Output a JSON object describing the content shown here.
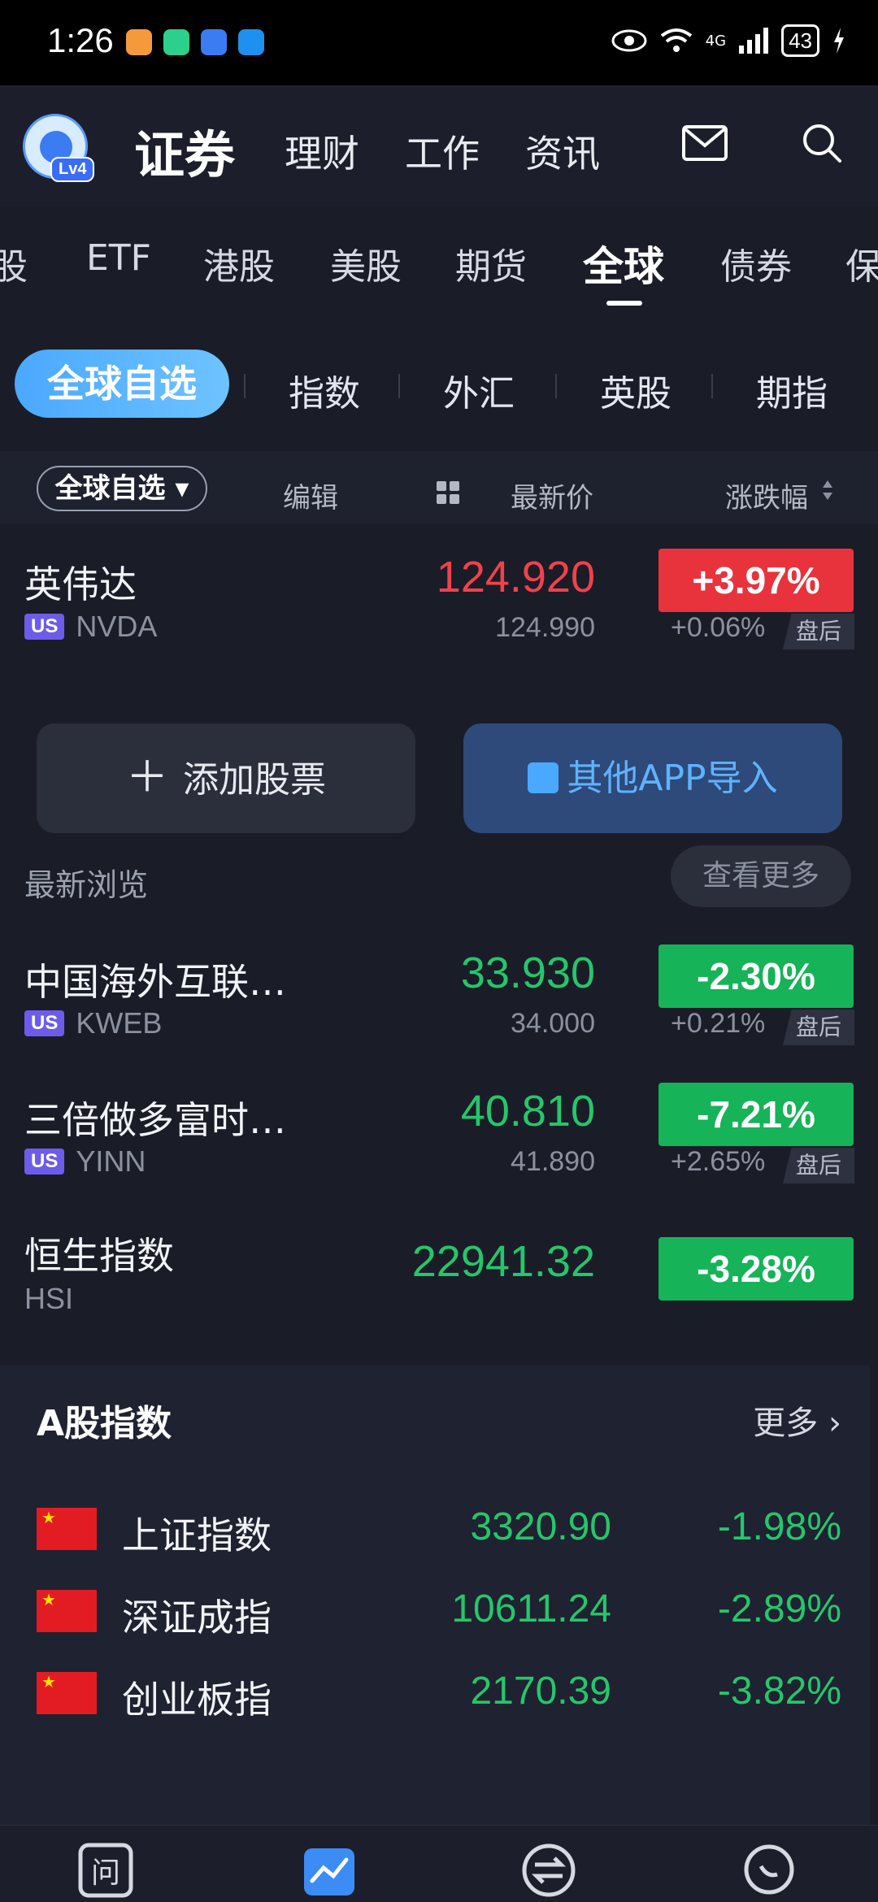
{
  "status_bar": {
    "time": "1:26",
    "network": "4G",
    "battery": "43"
  },
  "header": {
    "brand": "证券",
    "level": "Lv4",
    "nav": [
      "理财",
      "工作",
      "资讯"
    ]
  },
  "market_tabs": [
    "股",
    "ETF",
    "港股",
    "美股",
    "期货",
    "全球",
    "债券",
    "保"
  ],
  "market_tab_active": "全球",
  "sub_tabs": {
    "active": "全球自选",
    "items": [
      "指数",
      "外汇",
      "英股",
      "期指"
    ]
  },
  "watchlist_header": {
    "select": "全球自选 ▾",
    "edit": "编辑",
    "latest_price": "最新价",
    "change": "涨跌幅"
  },
  "watchlist": [
    {
      "name": "英伟达",
      "market": "US",
      "code": "NVDA",
      "price": "124.920",
      "after_price": "124.990",
      "change": "+3.97%",
      "after_change": "+0.06%",
      "after_label": "盘后",
      "direction": "up"
    }
  ],
  "buttons": {
    "add": "添加股票",
    "import": "其他APP导入"
  },
  "recent": {
    "title": "最新浏览",
    "see_more": "查看更多",
    "items": [
      {
        "name": "中国海外互联…",
        "market": "US",
        "code": "KWEB",
        "price": "33.930",
        "after_price": "34.000",
        "change": "-2.30%",
        "after_change": "+0.21%",
        "after_label": "盘后"
      },
      {
        "name": "三倍做多富时…",
        "market": "US",
        "code": "YINN",
        "price": "40.810",
        "after_price": "41.890",
        "change": "-7.21%",
        "after_change": "+2.65%",
        "after_label": "盘后"
      },
      {
        "name": "恒生指数",
        "code": "HSI",
        "price": "22941.32",
        "change": "-3.28%"
      }
    ]
  },
  "a_share": {
    "title": "A股指数",
    "more": "更多 ›",
    "items": [
      {
        "name": "上证指数",
        "value": "3320.90",
        "change": "-1.98%"
      },
      {
        "name": "深证成指",
        "value": "10611.24",
        "change": "-2.89%"
      },
      {
        "name": "创业板指",
        "value": "2170.39",
        "change": "-3.82%"
      }
    ]
  },
  "bottom_nav": [
    {
      "icon": "ask-icon",
      "label": "问"
    },
    {
      "icon": "market-chart-icon"
    },
    {
      "icon": "trade-exchange-icon"
    },
    {
      "icon": "chat-bubble-icon"
    }
  ],
  "colors": {
    "up": "#e8333d",
    "down": "#16b358",
    "accent": "#4aa8ff",
    "background": "#1a1d28"
  }
}
